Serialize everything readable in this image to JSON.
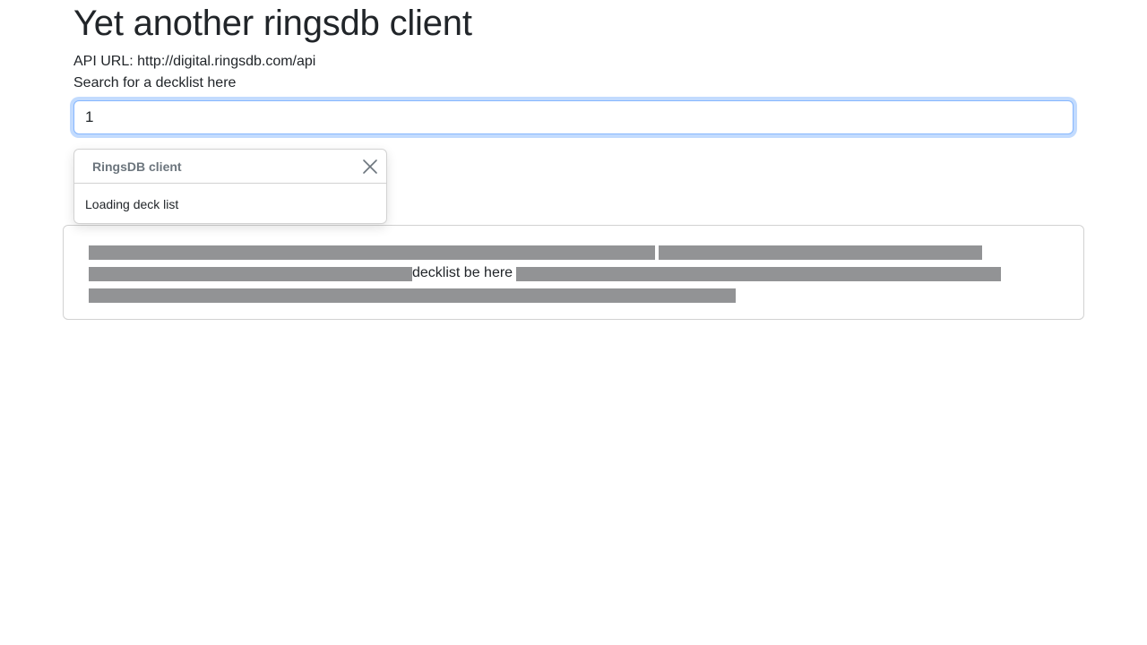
{
  "header": {
    "title": "Yet another ringsdb client",
    "api_url_line": "API URL: http://digital.ringsdb.com/api"
  },
  "search": {
    "label": "Search for a decklist here",
    "value": "1"
  },
  "toast": {
    "title": "RingsDB client",
    "message": "Loading deck list",
    "close_icon": "close-icon"
  },
  "decklist": {
    "text": "decklist be here"
  },
  "colors": {
    "focus_border": "#86b7fe",
    "placeholder_gray": "#929395",
    "text": "#212529"
  }
}
